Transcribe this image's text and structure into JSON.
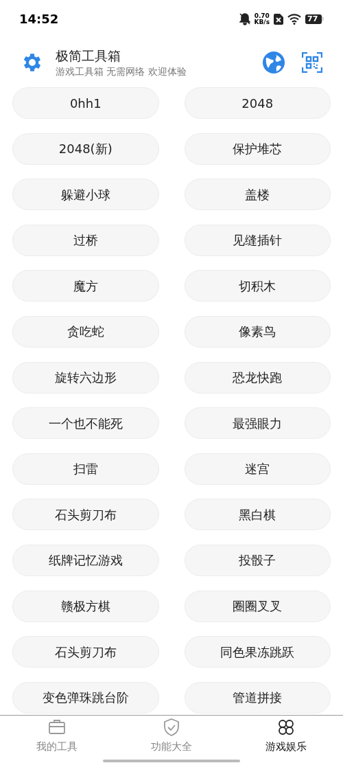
{
  "status_bar": {
    "time": "14:52",
    "speed_value": "0.70",
    "speed_unit": "KB/s",
    "battery": "77"
  },
  "header": {
    "title": "极简工具箱",
    "subtitle": "游戏工具箱 无需网络 欢迎体验"
  },
  "games": [
    "0hh1",
    "2048",
    "2048(新)",
    "保护堆芯",
    "躲避小球",
    "盖楼",
    "过桥",
    "见缝插针",
    "魔方",
    "切积木",
    "贪吃蛇",
    "像素鸟",
    "旋转六边形",
    "恐龙快跑",
    "一个也不能死",
    "最强眼力",
    "扫雷",
    "迷宫",
    "石头剪刀布",
    "黑白棋",
    "纸牌记忆游戏",
    "投骰子",
    "赣极方棋",
    "圈圈叉叉",
    "石头剪刀布",
    "同色果冻跳跃",
    "变色弹珠跳台阶",
    "管道拼接"
  ],
  "bottom_nav": [
    {
      "label": "我的工具",
      "kind": "toolbox",
      "selected": false
    },
    {
      "label": "功能大全",
      "kind": "shield",
      "selected": false
    },
    {
      "label": "游戏娱乐",
      "kind": "clover",
      "selected": true
    }
  ]
}
